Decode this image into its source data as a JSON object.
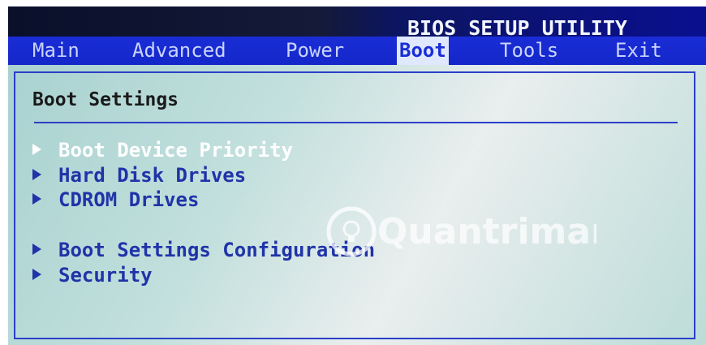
{
  "header": {
    "title": "BIOS SETUP UTILITY"
  },
  "menu": {
    "items": [
      "Main",
      "Advanced",
      "Power",
      "Boot",
      "Tools",
      "Exit"
    ],
    "active": "Boot"
  },
  "content": {
    "section_title": "Boot Settings",
    "options": [
      {
        "label": "Boot Device Priority",
        "selected": true
      },
      {
        "label": "Hard Disk Drives",
        "selected": false
      },
      {
        "label": "CDROM Drives",
        "selected": false
      },
      {
        "label": "Boot Settings Configuration",
        "selected": false
      },
      {
        "label": "Security",
        "selected": false
      }
    ]
  },
  "watermark": {
    "text": "Quantrimang"
  },
  "colors": {
    "menubar": "#1a2dd6",
    "active_tab_bg": "#dfe8ff",
    "option_text": "#2033a8",
    "selected_text": "#ffffff",
    "panel_bg": "#c3e0dd"
  }
}
